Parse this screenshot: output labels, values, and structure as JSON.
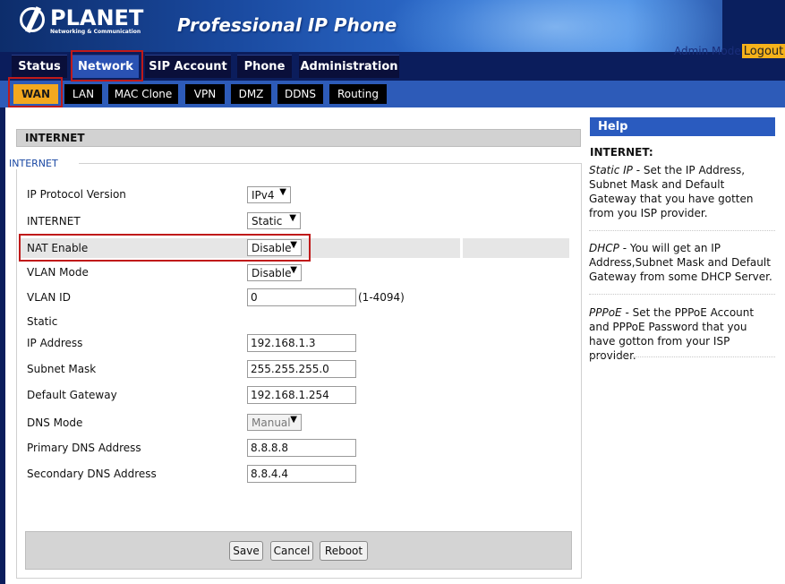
{
  "header": {
    "logo_text": "PLANET",
    "logo_sub": "Networking & Communication",
    "product_title": "Professional IP Phone",
    "admin_mode": "Admin Mode",
    "logout": "Logout"
  },
  "main_tabs": [
    "Status",
    "Network",
    "SIP Account",
    "Phone",
    "Administration"
  ],
  "main_tab_active": "Network",
  "sub_tabs": [
    "WAN",
    "LAN",
    "MAC Clone",
    "VPN",
    "DMZ",
    "DDNS",
    "Routing"
  ],
  "sub_tab_active": "WAN",
  "section_title": "INTERNET",
  "fieldset_legend": "INTERNET",
  "form": {
    "ip_protocol_label": "IP Protocol Version",
    "ip_protocol_value": "IPv4",
    "internet_label": "INTERNET",
    "internet_value": "Static",
    "nat_label": "NAT Enable",
    "nat_value": "Disable",
    "vlan_mode_label": "VLAN Mode",
    "vlan_mode_value": "Disable",
    "vlan_id_label": "VLAN ID",
    "vlan_id_value": "0",
    "vlan_id_range": "(1-4094)",
    "static_label": "Static",
    "ip_address_label": "IP Address",
    "ip_address_value": "192.168.1.3",
    "subnet_mask_label": "Subnet Mask",
    "subnet_mask_value": "255.255.255.0",
    "gateway_label": "Default Gateway",
    "gateway_value": "192.168.1.254",
    "dns_mode_label": "DNS Mode",
    "dns_mode_value": "Manual",
    "primary_dns_label": "Primary DNS Address",
    "primary_dns_value": "8.8.8.8",
    "secondary_dns_label": "Secondary DNS Address",
    "secondary_dns_value": "8.8.4.4"
  },
  "buttons": {
    "save": "Save",
    "cancel": "Cancel",
    "reboot": "Reboot"
  },
  "help": {
    "header": "Help",
    "title": "INTERNET:",
    "static_term": "Static IP",
    "static_text": " - Set the IP Address, Subnet Mask and Default Gateway that you have gotten from you ISP provider.",
    "dhcp_term": "DHCP",
    "dhcp_text": " - You will get an IP Address,Subnet Mask and Default Gateway from some DHCP Server.",
    "pppoe_term": "PPPoE",
    "pppoe_text": " - Set the PPPoE Account and PPPoE Password that you have gotton from your ISP provider."
  },
  "colors": {
    "nav_dark": "#0b1d5c",
    "tab_active": "#2a52b3",
    "subtab_active": "#f3a81e",
    "highlight_box": "#c01a1a",
    "help_header": "#2a5bbf"
  }
}
